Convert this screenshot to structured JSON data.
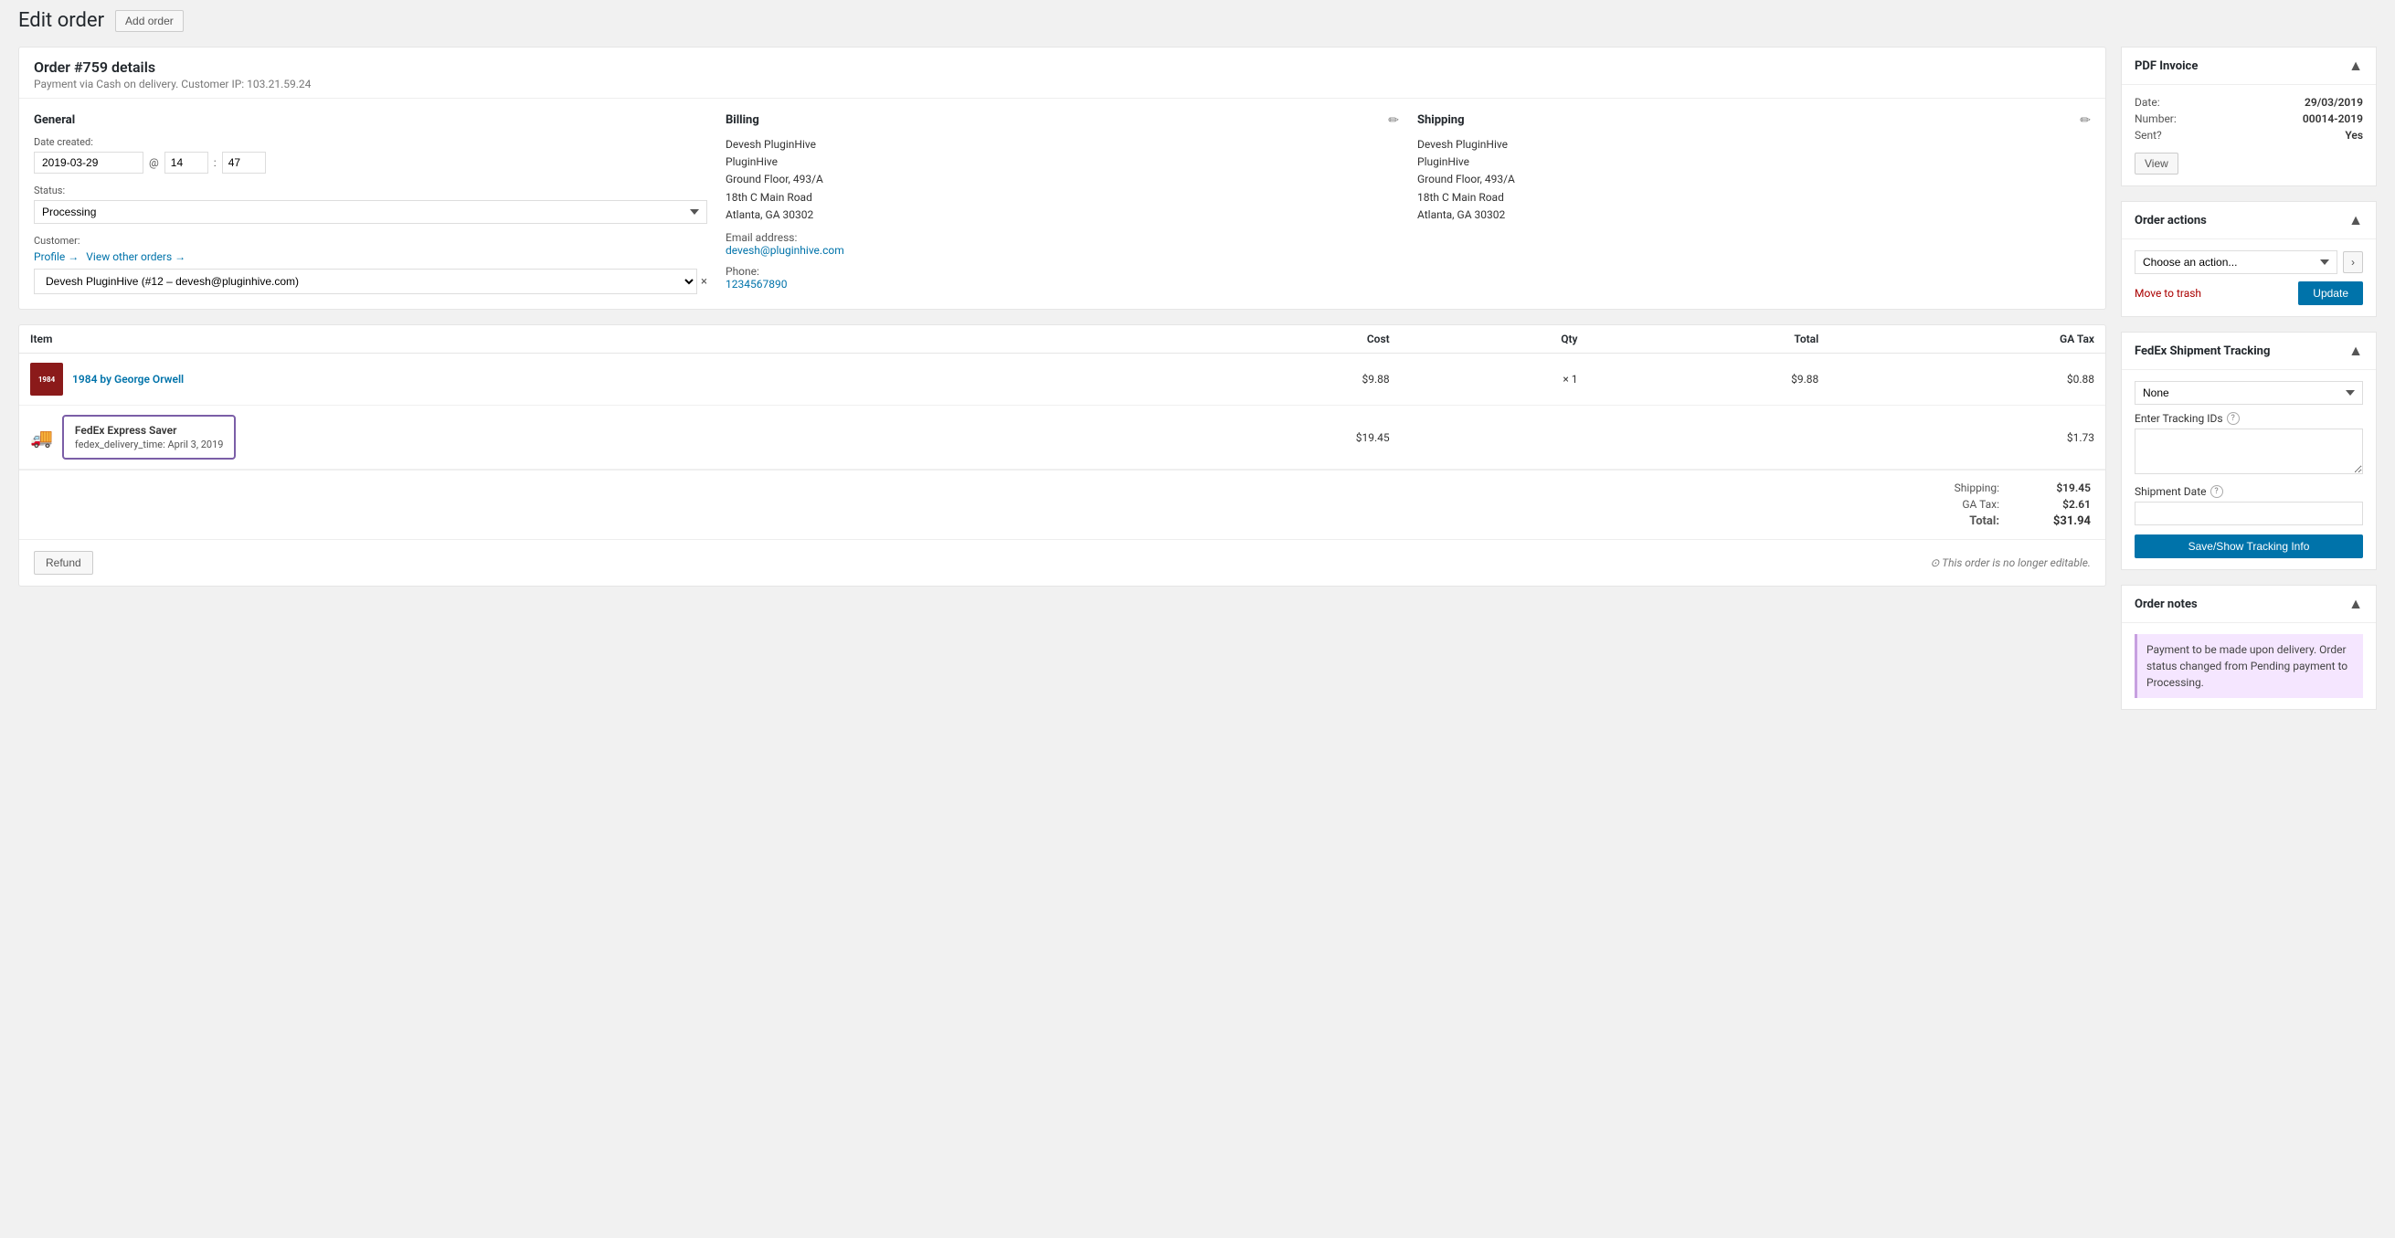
{
  "page": {
    "title": "Edit order",
    "add_order_label": "Add order"
  },
  "order": {
    "title": "Order #759 details",
    "subtitle": "Payment via Cash on delivery. Customer IP: 103.21.59.24"
  },
  "general": {
    "section_title": "General",
    "date_label": "Date created:",
    "date_value": "2019-03-29",
    "at": "@",
    "hour": "14",
    "minute": "47",
    "status_label": "Status:",
    "status_value": "Processing",
    "customer_label": "Customer:",
    "profile_link": "Profile →",
    "view_other_link": "View other orders →",
    "customer_value": "Devesh PluginHive (#12 – devesh@pluginhive.com)"
  },
  "billing": {
    "section_title": "Billing",
    "address": [
      "Devesh PluginHive",
      "PluginHive",
      "Ground Floor, 493/A",
      "18th C Main Road",
      "Atlanta, GA 30302"
    ],
    "email_label": "Email address:",
    "email_value": "devesh@pluginhive.com",
    "phone_label": "Phone:",
    "phone_value": "1234567890"
  },
  "shipping": {
    "section_title": "Shipping",
    "address": [
      "Devesh PluginHive",
      "PluginHive",
      "Ground Floor, 493/A",
      "18th C Main Road",
      "Atlanta, GA 30302"
    ]
  },
  "items": {
    "col_item": "Item",
    "col_cost": "Cost",
    "col_qty": "Qty",
    "col_total": "Total",
    "col_ga_tax": "GA Tax",
    "product": {
      "name": "1984 by George Orwell",
      "cost": "$9.88",
      "qty": "× 1",
      "total": "$9.88",
      "ga_tax": "$0.88"
    },
    "shipping_item": {
      "name": "FedEx Express Saver",
      "meta": "fedex_delivery_time: April 3, 2019",
      "cost": "$19.45",
      "ga_tax": "$1.73"
    }
  },
  "totals": {
    "shipping_label": "Shipping:",
    "shipping_value": "$19.45",
    "ga_tax_label": "GA Tax:",
    "ga_tax_value": "$2.61",
    "total_label": "Total:",
    "total_value": "$31.94"
  },
  "footer": {
    "refund_label": "Refund",
    "not_editable": "⊙ This order is no longer editable."
  },
  "pdf_invoice": {
    "title": "PDF Invoice",
    "date_label": "Date:",
    "date_value": "29/03/2019",
    "number_label": "Number:",
    "number_value": "00014-2019",
    "sent_label": "Sent?",
    "sent_value": "Yes",
    "view_label": "View"
  },
  "order_actions": {
    "title": "Order actions",
    "select_placeholder": "Choose an action...",
    "move_trash_label": "Move to trash",
    "update_label": "Update"
  },
  "fedex_tracking": {
    "title": "FedEx Shipment Tracking",
    "select_value": "None",
    "tracking_ids_label": "Enter Tracking IDs",
    "shipment_date_label": "Shipment Date",
    "save_label": "Save/Show Tracking Info"
  },
  "order_notes": {
    "title": "Order notes",
    "note_text": "Payment to be made upon delivery. Order status changed from Pending payment to Processing."
  }
}
